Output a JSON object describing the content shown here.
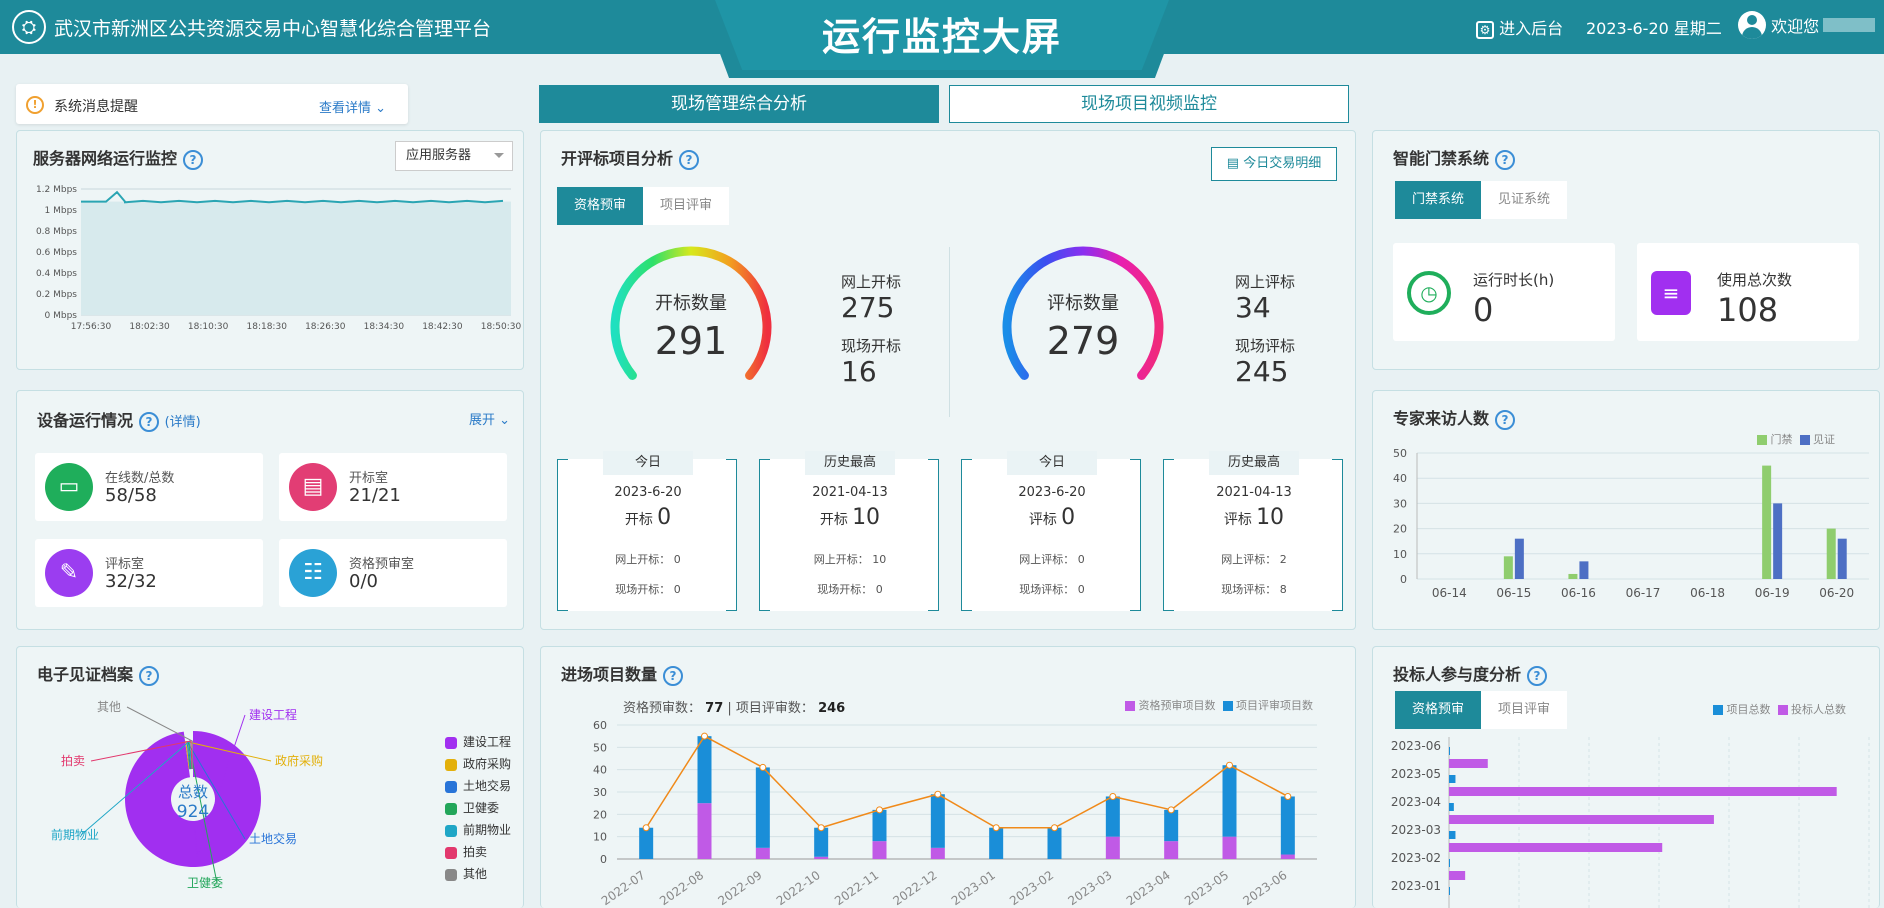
{
  "header": {
    "platform_title": "武汉市新洲区公共资源交易中心智慧化综合管理平台",
    "screen_title": "运行监控大屏",
    "enter_backend": "进入后台",
    "date": "2023-6-20 星期二",
    "welcome": "欢迎您"
  },
  "notice": {
    "label": "系统消息提醒",
    "link": "查看详情"
  },
  "main_tabs": [
    {
      "label": "现场管理综合分析"
    },
    {
      "label": "现场项目视频监控"
    }
  ],
  "server": {
    "title": "服务器网络运行监控",
    "select": "应用服务器",
    "y_ticks": [
      "1.2 Mbps",
      "1 Mbps",
      "0.8 Mbps",
      "0.6 Mbps",
      "0.4 Mbps",
      "0.2 Mbps",
      "0 Mbps"
    ],
    "x_ticks": [
      "17:56:30",
      "18:02:30",
      "18:10:30",
      "18:18:30",
      "18:26:30",
      "18:34:30",
      "18:42:30",
      "18:50:30"
    ]
  },
  "devices": {
    "title": "设备运行情况",
    "detail": "(详情)",
    "expand": "展开",
    "items": [
      {
        "label": "在线数/总数",
        "value": "58/58",
        "color": "#1fae5b"
      },
      {
        "label": "开标室",
        "value": "21/21",
        "color": "#e23d74"
      },
      {
        "label": "评标室",
        "value": "32/32",
        "color": "#9b3df0"
      },
      {
        "label": "资格预审室",
        "value": "0/0",
        "color": "#2aa2d6"
      }
    ]
  },
  "archive": {
    "title": "电子见证档案",
    "total_label": "总数",
    "total": "924",
    "legend": [
      {
        "name": "建设工程",
        "color": "#a12ff0"
      },
      {
        "name": "政府采购",
        "color": "#e3b00b"
      },
      {
        "name": "土地交易",
        "color": "#2874d8"
      },
      {
        "name": "卫健委",
        "color": "#22a65a"
      },
      {
        "name": "前期物业",
        "color": "#1fa6c6"
      },
      {
        "name": "拍卖",
        "color": "#e2386d"
      },
      {
        "name": "其他",
        "color": "#888888"
      }
    ]
  },
  "bid": {
    "title": "开评标项目分析",
    "detail_btn": "今日交易明细",
    "tabs": [
      "资格预审",
      "项目评审"
    ],
    "open": {
      "label": "开标数量",
      "total": "291",
      "online_label": "网上开标",
      "online": "275",
      "onsite_label": "现场开标",
      "onsite": "16"
    },
    "eval": {
      "label": "评标数量",
      "total": "279",
      "online_label": "网上评标",
      "online": "34",
      "onsite_label": "现场评标",
      "onsite": "245"
    },
    "cards": [
      {
        "tag": "今日",
        "date": "2023-6-20",
        "kind": "开标",
        "value": "0",
        "l1": "网上开标：",
        "v1": "0",
        "l2": "现场开标：",
        "v2": "0"
      },
      {
        "tag": "历史最高",
        "date": "2021-04-13",
        "kind": "开标",
        "value": "10",
        "l1": "网上开标：",
        "v1": "10",
        "l2": "现场开标：",
        "v2": "0"
      },
      {
        "tag": "今日",
        "date": "2023-6-20",
        "kind": "评标",
        "value": "0",
        "l1": "网上评标：",
        "v1": "0",
        "l2": "现场评标：",
        "v2": "0"
      },
      {
        "tag": "历史最高",
        "date": "2021-04-13",
        "kind": "评标",
        "value": "10",
        "l1": "网上评标：",
        "v1": "2",
        "l2": "现场评标：",
        "v2": "8"
      }
    ]
  },
  "entry": {
    "title": "进场项目数量",
    "summary_a_label": "资格预审数：",
    "summary_a": "77",
    "sep": "|",
    "summary_b_label": "项目评审数：",
    "summary_b": "246",
    "legend_a": "资格预审项目数",
    "legend_b": "项目评审项目数"
  },
  "access": {
    "title": "智能门禁系统",
    "tabs": [
      "门禁系统",
      "见证系统"
    ],
    "runtime_label": "运行时长(h)",
    "runtime": "0",
    "uses_label": "使用总次数",
    "uses": "108"
  },
  "experts": {
    "title": "专家来访人数",
    "legend_a": "门禁",
    "legend_b": "见证"
  },
  "bidders": {
    "title": "投标人参与度分析",
    "tabs": [
      "资格预审",
      "项目评审"
    ],
    "legend_a": "项目总数",
    "legend_b": "投标人总数"
  },
  "chart_data": [
    {
      "type": "line",
      "title": "服务器网络运行监控",
      "x": [
        "17:56:30",
        "18:02:30",
        "18:10:30",
        "18:18:30",
        "18:26:30",
        "18:34:30",
        "18:42:30",
        "18:50:30"
      ],
      "y_unit": "Mbps",
      "ylim": [
        0,
        1.2
      ],
      "series": [
        {
          "values": [
            1.08,
            1.08,
            1.08,
            1.08,
            1.08,
            1.08,
            1.08,
            1.08
          ]
        }
      ]
    },
    {
      "type": "pie",
      "title": "电子见证档案",
      "categories": [
        "建设工程",
        "政府采购",
        "土地交易",
        "卫健委",
        "前期物业",
        "拍卖",
        "其他"
      ],
      "values": [
        810,
        3,
        3,
        3,
        3,
        3,
        3
      ]
    },
    {
      "type": "bar",
      "title": "进场项目数量",
      "categories": [
        "2022-07",
        "2022-08",
        "2022-09",
        "2022-10",
        "2022-11",
        "2022-12",
        "2023-01",
        "2023-02",
        "2023-03",
        "2023-04",
        "2023-05",
        "2023-06"
      ],
      "ylim": [
        0,
        60
      ],
      "y_ticks": [
        0,
        10,
        20,
        30,
        40,
        50,
        60
      ],
      "series": [
        {
          "name": "资格预审项目数",
          "values": [
            0,
            25,
            5,
            1,
            8,
            5,
            0,
            0,
            10,
            8,
            10,
            2
          ]
        },
        {
          "name": "项目评审项目数",
          "values": [
            14,
            30,
            36,
            13,
            14,
            24,
            14,
            14,
            18,
            14,
            32,
            26
          ]
        }
      ]
    },
    {
      "type": "bar",
      "title": "专家来访人数",
      "categories": [
        "06-14",
        "06-15",
        "06-16",
        "06-17",
        "06-18",
        "06-19",
        "06-20"
      ],
      "ylim": [
        0,
        50
      ],
      "y_ticks": [
        0,
        10,
        20,
        30,
        40,
        50
      ],
      "series": [
        {
          "name": "门禁",
          "values": [
            0,
            9,
            2,
            0,
            0,
            45,
            20
          ]
        },
        {
          "name": "见证",
          "values": [
            0,
            16,
            7,
            0,
            0,
            30,
            16
          ]
        }
      ]
    },
    {
      "type": "bar",
      "title": "投标人参与度分析",
      "categories": [
        "2023-06",
        "2023-05",
        "2023-04",
        "2023-03",
        "2023-02",
        "2023-01"
      ],
      "series": [
        {
          "name": "项目总数",
          "values": [
            0.3,
            2,
            1.5,
            2,
            0.3,
            0.3
          ]
        },
        {
          "name": "投标人总数",
          "values": [
            12,
            120,
            82,
            66,
            5,
            0
          ]
        }
      ]
    }
  ]
}
